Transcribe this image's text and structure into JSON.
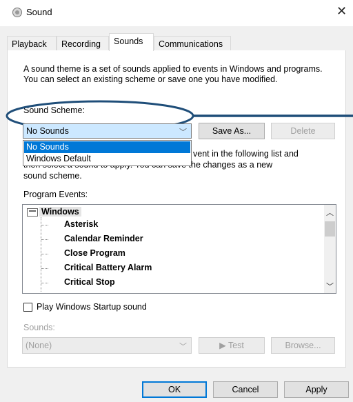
{
  "window": {
    "title": "Sound",
    "close_glyph": "✕"
  },
  "tabs": [
    {
      "label": "Playback"
    },
    {
      "label": "Recording"
    },
    {
      "label": "Sounds"
    },
    {
      "label": "Communications"
    }
  ],
  "description": "A sound theme is a set of sounds applied to events in Windows and programs.  You can select an existing scheme or save one you have modified.",
  "scheme": {
    "label": "Sound Scheme:",
    "selected": "No Sounds",
    "options": [
      "No Sounds",
      "Windows Default"
    ],
    "save_as": "Save As...",
    "delete": "Delete"
  },
  "events_description": {
    "line1_tail": "vent in the following list and",
    "line2": "then select a sound to apply.  You can save the changes as a new",
    "line3": "sound scheme."
  },
  "program_events": {
    "label": "Program Events:",
    "root": "Windows",
    "items": [
      "Asterisk",
      "Calendar Reminder",
      "Close Program",
      "Critical Battery Alarm",
      "Critical Stop"
    ]
  },
  "startup": {
    "label": "Play Windows Startup sound"
  },
  "sounds": {
    "label": "Sounds:",
    "value": "(None)",
    "test": "Test",
    "browse": "Browse..."
  },
  "footer": {
    "ok": "OK",
    "cancel": "Cancel",
    "apply": "Apply"
  },
  "colors": {
    "selection": "#0078d7",
    "annotation": "#1f4e79",
    "combo_highlight": "#cce8ff"
  }
}
